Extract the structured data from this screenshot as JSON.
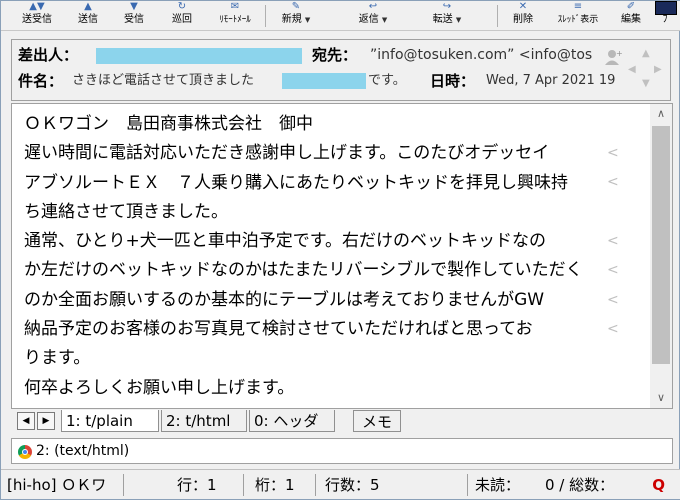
{
  "toolbar": {
    "buttons": [
      {
        "label": "送受信",
        "icon": "send-receive-icon"
      },
      {
        "label": "送信",
        "icon": "send-icon"
      },
      {
        "label": "受信",
        "icon": "receive-icon"
      },
      {
        "label": "巡回",
        "icon": "patrol-icon"
      },
      {
        "label": "ﾘﾓｰﾄﾒｰﾙ",
        "icon": "remote-mail-icon"
      },
      {
        "label": "新規",
        "icon": "new-mail-icon"
      },
      {
        "label": "返信",
        "icon": "reply-icon"
      },
      {
        "label": "転送",
        "icon": "forward-icon"
      },
      {
        "label": "削除",
        "icon": "delete-icon"
      },
      {
        "label": "ｽﾚｯﾄﾞ表示",
        "icon": "thread-view-icon"
      },
      {
        "label": "編集",
        "icon": "edit-icon"
      },
      {
        "label": "ﾌ",
        "icon": "more-icon"
      }
    ]
  },
  "header": {
    "from_label": "差出人：",
    "to_label": "宛先：",
    "to_value": "”info@tosuken.com” <info@tos",
    "subject_label": "件名：",
    "subject_value_pre": "さきほど電話させて頂きました",
    "subject_value_post": "です。",
    "date_label": "日時：",
    "date_value": "Wed, 7 Apr 2021 19"
  },
  "body": {
    "lines": [
      "ＯＫワゴン　島田商事株式会社　御中",
      "遅い時間に電話対応いただき感謝申し上げます。このたびオデッセイ",
      "アブソルートＥＸ　７人乗り購入にあたりベットキッドを拝見し興味持",
      "ち連絡させて頂きました。",
      "通常、ひとり+犬一匹と車中泊予定です。右だけのベットキッドなの",
      "か左だけのベットキッドなのかはたまたリバーシブルで製作していただく",
      "のか全面お願いするのか基本的にテーブルは考えておりませんがGW",
      "納品予定のお客様のお写真見て検討させていただければと思ってお",
      "ります。",
      "何卒よろしくお願い申し上げます。"
    ],
    "wrap_marker": "<"
  },
  "tabs": {
    "items": [
      "1: t/plain",
      "2: t/html",
      "0: ヘッダ"
    ],
    "memo": "メモ",
    "prev": "◀",
    "next": "▶"
  },
  "attachment": {
    "text": "2: (text/html)"
  },
  "status": {
    "account": "[hi-ho] ＯＫワ",
    "line": "行：1",
    "column": "桁：1",
    "line_count": "行数：5",
    "unread_label": "未読：",
    "unread_total": "0 / 総数：",
    "q": "Q"
  },
  "colors": {
    "redact": "#8cd4ec",
    "scroll_thumb": "#c0c0c0"
  }
}
